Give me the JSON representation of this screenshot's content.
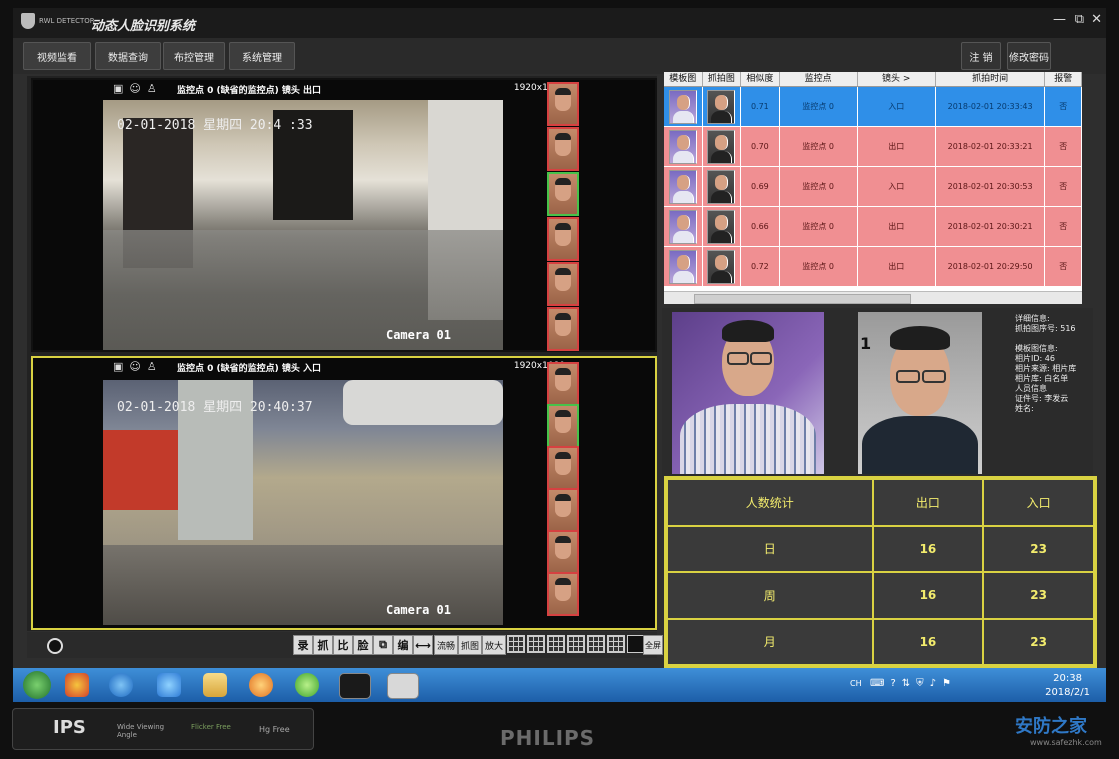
{
  "app": {
    "logo_text": "RWL DETECTOR",
    "title": "动态人脸识别系统"
  },
  "nav": {
    "tabs": [
      "视频监看",
      "数据查询",
      "布控管理",
      "系统管理"
    ],
    "logout": "注 销",
    "change_password": "修改密码"
  },
  "video": {
    "top": {
      "label": "监控点 0 (缺省的监控点) 镜头 出口",
      "resolution": "1920x1080",
      "timestamp": "02-01-2018  星期四  20:4   :33",
      "camera": "Camera 01"
    },
    "bottom": {
      "label": "监控点 0 (缺省的监控点) 镜头 入口",
      "resolution": "1920x1080",
      "timestamp": "02-01-2018  星期四  20:40:37",
      "camera": "Camera 01"
    }
  },
  "toolbar": {
    "buttons": [
      "录",
      "抓",
      "比",
      "脸",
      "⧉",
      "编",
      "⟷"
    ],
    "small_buttons": [
      "流畅",
      "抓图",
      "放大"
    ],
    "fullscreen": "全屏"
  },
  "results": {
    "columns": [
      "模板图",
      "抓拍图",
      "相似度",
      "监控点",
      "镜头 >",
      "抓拍时间",
      "报警"
    ],
    "rows": [
      {
        "similarity": "0.71",
        "point": "监控点 0",
        "lens": "入口",
        "time": "2018-02-01 20:33:43",
        "alarm": "否"
      },
      {
        "similarity": "0.70",
        "point": "监控点 0",
        "lens": "出口",
        "time": "2018-02-01 20:33:21",
        "alarm": "否"
      },
      {
        "similarity": "0.69",
        "point": "监控点 0",
        "lens": "入口",
        "time": "2018-02-01 20:30:53",
        "alarm": "否"
      },
      {
        "similarity": "0.66",
        "point": "监控点 0",
        "lens": "出口",
        "time": "2018-02-01 20:30:21",
        "alarm": "否"
      },
      {
        "similarity": "0.72",
        "point": "监控点 0",
        "lens": "出口",
        "time": "2018-02-01 20:29:50",
        "alarm": "否"
      }
    ]
  },
  "detail": {
    "photo_index": "1",
    "lines": [
      "详细信息:",
      "抓拍图序号: 516",
      "",
      "模板图信息:",
      "相片ID: 46",
      "相片来源: 相片库",
      "相片库: 白名单",
      "人员信息",
      "证件号: 李发云",
      "姓名:"
    ]
  },
  "stats": {
    "header": [
      "人数统计",
      "出口",
      "入口"
    ],
    "rows": [
      {
        "label": "日",
        "exit": "16",
        "entry": "23"
      },
      {
        "label": "周",
        "exit": "16",
        "entry": "23"
      },
      {
        "label": "月",
        "exit": "16",
        "entry": "23"
      }
    ]
  },
  "taskbar": {
    "tray_text": "CH",
    "time": "20:38",
    "date": "2018/2/1"
  },
  "bezel": {
    "brand": "PHILIPS",
    "badge_ips": "IPS",
    "badge_wide": "Wide Viewing Angle",
    "badge_flicker": "Flicker Free",
    "badge_hg": "Hg Free",
    "watermark": "安防之家",
    "watermark_url": "www.safezhk.com"
  },
  "colors": {
    "accent_yellow": "#d9d242",
    "row_selected": "#2f8fe8",
    "row_pink": "#f08f92",
    "taskbar": "#2a76c6"
  }
}
